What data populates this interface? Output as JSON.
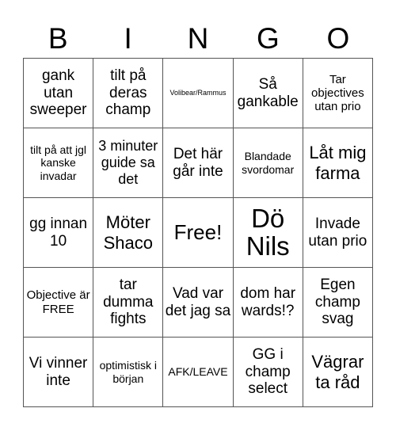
{
  "header": {
    "letters": [
      "B",
      "I",
      "N",
      "G",
      "O"
    ]
  },
  "cells": [
    [
      "gank utan sweeper",
      "tilt på deras champ",
      "Volibear/Rammus",
      "Så gankable",
      "Tar objectives utan prio"
    ],
    [
      "tilt på att jgl kanske invadar",
      "3 minuter guide sa det",
      "Det här går inte",
      "Blandade svordomar",
      "Låt mig farma"
    ],
    [
      "gg innan 10",
      "Möter Shaco",
      "Free!",
      "Dö Nils",
      "Invade utan prio"
    ],
    [
      "Objective är FREE",
      "tar dumma fights",
      "Vad var det jag sa",
      "dom har wards!?",
      "Egen champ svag"
    ],
    [
      "Vi vinner inte",
      "optimistisk i början",
      "AFK/LEAVE",
      "GG i champ select",
      "Vägrar ta råd"
    ]
  ]
}
